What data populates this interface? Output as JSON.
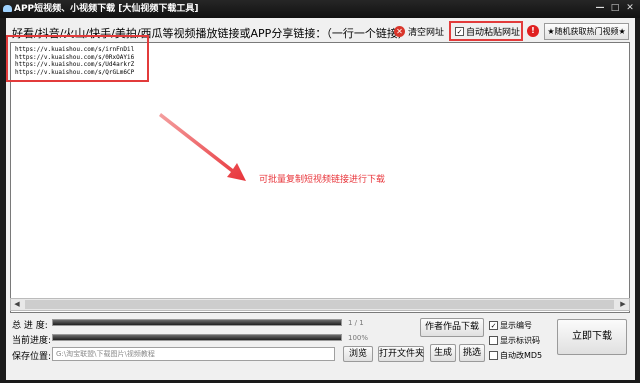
{
  "window": {
    "title": "APP短视频、小视频下载 [大仙视频下载工具]",
    "controls": [
      "—",
      "□",
      "✕"
    ]
  },
  "header": {
    "label": "好看/抖音/火山/快手/美拍/西瓜等视频播放链接或APP分享链接：（一行一个链接）",
    "clear_label": "清空网址",
    "auto_paste_label": "自动粘贴网址",
    "auto_paste_checked": true,
    "badge": "!",
    "hot_button_label": "★随机获取热门视频★"
  },
  "links": [
    "https://v.kuaishou.com/s/irnFnDil",
    "https://v.kuaishou.com/s/0RxOAYi6",
    "https://v.kuaishou.com/s/Ud4arkrZ",
    "https://v.kuaishou.com/s/QrGLm6CP"
  ],
  "annotation": "可批量复制短视频链接进行下载",
  "progress": {
    "total_label": "总 进 度:",
    "total_text": "1 / 1",
    "total_value": 1.0,
    "current_label": "当前进度:",
    "current_text": "100%",
    "current_value": 1.0
  },
  "save": {
    "label": "保存位置:",
    "path": "G:\\淘宝联盟\\下载图片\\视频教程",
    "browse_label": "浏览",
    "open_folder_label": "打开文件夹"
  },
  "actions": {
    "author_download_label": "作者作品下载",
    "generate_label": "生成",
    "pick_label": "挑选",
    "download_now_label": "立即下载"
  },
  "options": [
    {
      "label": "显示编号",
      "checked": true
    },
    {
      "label": "显示标识码",
      "checked": false
    },
    {
      "label": "自动改MD5",
      "checked": false
    }
  ],
  "colors": {
    "highlight": "#e23b3b",
    "annotation": "#e8343a",
    "clear_icon": "#d9352a"
  }
}
